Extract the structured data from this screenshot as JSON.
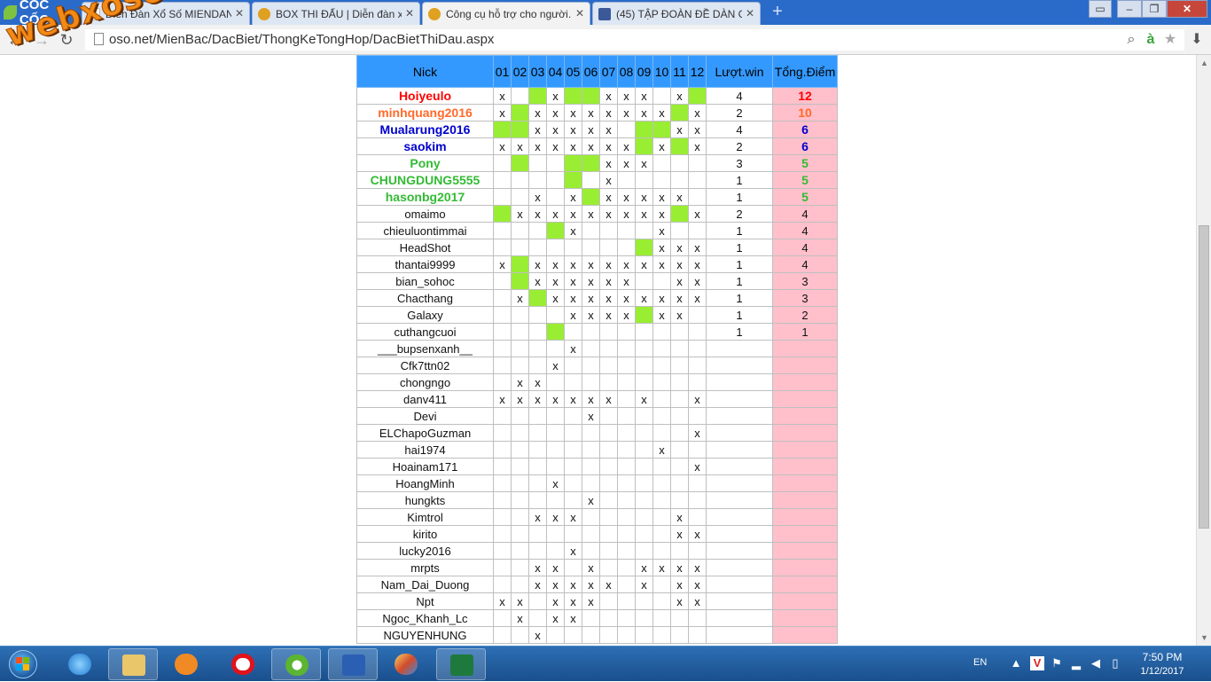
{
  "browser": {
    "brand": "CỐC CỐC",
    "tabs": [
      {
        "title": "Diễn Đàn Xổ Số MIENDAN...",
        "icon": "page-icon",
        "color": "#eeeeee"
      },
      {
        "title": "BOX THI ĐẤU | Diễn đàn xổ...",
        "icon": "xs-icon",
        "color": "#e0a020"
      },
      {
        "title": "Công cụ hỗ trợ cho người...",
        "icon": "xs-icon",
        "color": "#e0a020",
        "active": true
      },
      {
        "title": "(45) TẬP ĐOÀN ĐỀ DÀN G...",
        "icon": "facebook-icon",
        "color": "#3b5998"
      }
    ],
    "url": "oso.net/MienBac/DacBiet/ThongKeTongHop/DacBietThiDau.aspx",
    "watermark": "webxoso.net"
  },
  "table": {
    "headers": {
      "nick": "Nick",
      "days": [
        "01",
        "02",
        "03",
        "04",
        "05",
        "06",
        "07",
        "08",
        "09",
        "10",
        "11",
        "12"
      ],
      "win": "Lượt.win",
      "points": "Tổng.Điểm"
    },
    "rows": [
      {
        "nick": "Hoiyeulo",
        "color": "#ff0000",
        "cells": [
          "x",
          "",
          "G",
          "x",
          "G",
          "G",
          "x",
          "x",
          "x",
          "",
          "x",
          "G"
        ],
        "win": "4",
        "points": "12"
      },
      {
        "nick": "minhquang2016",
        "color": "#ff6a2a",
        "cells": [
          "x",
          "G",
          "x",
          "x",
          "x",
          "x",
          "x",
          "x",
          "x",
          "x",
          "G",
          "x"
        ],
        "win": "2",
        "points": "10"
      },
      {
        "nick": "Mualarung2016",
        "color": "#0000cc",
        "cells": [
          "G",
          "G",
          "x",
          "x",
          "x",
          "x",
          "x",
          "",
          "G",
          "G",
          "x",
          "x"
        ],
        "win": "4",
        "points": "6"
      },
      {
        "nick": "saokim",
        "color": "#0000cc",
        "cells": [
          "x",
          "x",
          "x",
          "x",
          "x",
          "x",
          "x",
          "x",
          "G",
          "x",
          "G",
          "x"
        ],
        "win": "2",
        "points": "6"
      },
      {
        "nick": "Pony",
        "color": "#33bb33",
        "cells": [
          "",
          "G",
          "",
          "",
          "G",
          "G",
          "x",
          "x",
          "x",
          "",
          "",
          ""
        ],
        "win": "3",
        "points": "5"
      },
      {
        "nick": "CHUNGDUNG5555",
        "color": "#33bb33",
        "cells": [
          "",
          "",
          "",
          "",
          "G",
          "",
          "x",
          "",
          "",
          "",
          "",
          ""
        ],
        "win": "1",
        "points": "5"
      },
      {
        "nick": "hasonbg2017",
        "color": "#33bb33",
        "cells": [
          "",
          "",
          "x",
          "",
          "x",
          "G",
          "x",
          "x",
          "x",
          "x",
          "x",
          ""
        ],
        "win": "1",
        "points": "5"
      },
      {
        "nick": "omaimo",
        "color": "",
        "cells": [
          "G",
          "x",
          "x",
          "x",
          "x",
          "x",
          "x",
          "x",
          "x",
          "x",
          "G",
          "x"
        ],
        "win": "2",
        "points": "4"
      },
      {
        "nick": "chieuluontimmai",
        "color": "",
        "cells": [
          "",
          "",
          "",
          "G",
          "x",
          "",
          "",
          "",
          "",
          "x",
          "",
          ""
        ],
        "win": "1",
        "points": "4"
      },
      {
        "nick": "HeadShot",
        "color": "",
        "cells": [
          "",
          "",
          "",
          "",
          "",
          "",
          "",
          "",
          "G",
          "x",
          "x",
          "x"
        ],
        "win": "1",
        "points": "4"
      },
      {
        "nick": "thantai9999",
        "color": "",
        "cells": [
          "x",
          "G",
          "x",
          "x",
          "x",
          "x",
          "x",
          "x",
          "x",
          "x",
          "x",
          "x"
        ],
        "win": "1",
        "points": "4"
      },
      {
        "nick": "bian_sohoc",
        "color": "",
        "cells": [
          "",
          "G",
          "x",
          "x",
          "x",
          "x",
          "x",
          "x",
          "",
          "",
          "x",
          "x"
        ],
        "win": "1",
        "points": "3"
      },
      {
        "nick": "Chacthang",
        "color": "",
        "cells": [
          "",
          "x",
          "G",
          "x",
          "x",
          "x",
          "x",
          "x",
          "x",
          "x",
          "x",
          "x"
        ],
        "win": "1",
        "points": "3"
      },
      {
        "nick": "Galaxy",
        "color": "",
        "cells": [
          "",
          "",
          "",
          "",
          "x",
          "x",
          "x",
          "x",
          "G",
          "x",
          "x",
          ""
        ],
        "win": "1",
        "points": "2"
      },
      {
        "nick": "cuthangcuoi",
        "color": "",
        "cells": [
          "",
          "",
          "",
          "G",
          "",
          "",
          "",
          "",
          "",
          "",
          "",
          ""
        ],
        "win": "1",
        "points": "1"
      },
      {
        "nick": "___bupsenxanh__",
        "color": "",
        "cells": [
          "",
          "",
          "",
          "",
          "x",
          "",
          "",
          "",
          "",
          "",
          "",
          ""
        ],
        "win": "",
        "points": ""
      },
      {
        "nick": "Cfk7ttn02",
        "color": "",
        "cells": [
          "",
          "",
          "",
          "x",
          "",
          "",
          "",
          "",
          "",
          "",
          "",
          ""
        ],
        "win": "",
        "points": ""
      },
      {
        "nick": "chongngo",
        "color": "",
        "cells": [
          "",
          "x",
          "x",
          "",
          "",
          "",
          "",
          "",
          "",
          "",
          "",
          ""
        ],
        "win": "",
        "points": ""
      },
      {
        "nick": "danv411",
        "color": "",
        "cells": [
          "x",
          "x",
          "x",
          "x",
          "x",
          "x",
          "x",
          "",
          "x",
          "",
          "",
          "x"
        ],
        "win": "",
        "points": ""
      },
      {
        "nick": "Devi",
        "color": "",
        "cells": [
          "",
          "",
          "",
          "",
          "",
          "x",
          "",
          "",
          "",
          "",
          "",
          ""
        ],
        "win": "",
        "points": ""
      },
      {
        "nick": "ELChapoGuzman",
        "color": "",
        "cells": [
          "",
          "",
          "",
          "",
          "",
          "",
          "",
          "",
          "",
          "",
          "",
          "x"
        ],
        "win": "",
        "points": ""
      },
      {
        "nick": "hai1974",
        "color": "",
        "cells": [
          "",
          "",
          "",
          "",
          "",
          "",
          "",
          "",
          "",
          "x",
          "",
          ""
        ],
        "win": "",
        "points": ""
      },
      {
        "nick": "Hoainam171",
        "color": "",
        "cells": [
          "",
          "",
          "",
          "",
          "",
          "",
          "",
          "",
          "",
          "",
          "",
          "x"
        ],
        "win": "",
        "points": ""
      },
      {
        "nick": "HoangMinh",
        "color": "",
        "cells": [
          "",
          "",
          "",
          "x",
          "",
          "",
          "",
          "",
          "",
          "",
          "",
          ""
        ],
        "win": "",
        "points": ""
      },
      {
        "nick": "hungkts",
        "color": "",
        "cells": [
          "",
          "",
          "",
          "",
          "",
          "x",
          "",
          "",
          "",
          "",
          "",
          ""
        ],
        "win": "",
        "points": ""
      },
      {
        "nick": "Kimtrol",
        "color": "",
        "cells": [
          "",
          "",
          "x",
          "x",
          "x",
          "",
          "",
          "",
          "",
          "",
          "x",
          ""
        ],
        "win": "",
        "points": ""
      },
      {
        "nick": "kirito",
        "color": "",
        "cells": [
          "",
          "",
          "",
          "",
          "",
          "",
          "",
          "",
          "",
          "",
          "x",
          "x"
        ],
        "win": "",
        "points": ""
      },
      {
        "nick": "lucky2016",
        "color": "",
        "cells": [
          "",
          "",
          "",
          "",
          "x",
          "",
          "",
          "",
          "",
          "",
          "",
          ""
        ],
        "win": "",
        "points": ""
      },
      {
        "nick": "mrpts",
        "color": "",
        "cells": [
          "",
          "",
          "x",
          "x",
          "",
          "x",
          "",
          "",
          "x",
          "x",
          "x",
          "x"
        ],
        "win": "",
        "points": ""
      },
      {
        "nick": "Nam_Dai_Duong",
        "color": "",
        "cells": [
          "",
          "",
          "x",
          "x",
          "x",
          "x",
          "x",
          "",
          "x",
          "",
          "x",
          "x"
        ],
        "win": "",
        "points": ""
      },
      {
        "nick": "Npt",
        "color": "",
        "cells": [
          "x",
          "x",
          "",
          "x",
          "x",
          "x",
          "",
          "",
          "",
          "",
          "x",
          "x"
        ],
        "win": "",
        "points": ""
      },
      {
        "nick": "Ngoc_Khanh_Lc",
        "color": "",
        "cells": [
          "",
          "x",
          "",
          "x",
          "x",
          "",
          "",
          "",
          "",
          "",
          "",
          ""
        ],
        "win": "",
        "points": ""
      },
      {
        "nick": "NGUYENHUNG",
        "color": "",
        "cells": [
          "",
          "",
          "x",
          "",
          "",
          "",
          "",
          "",
          "",
          "",
          "",
          ""
        ],
        "win": "",
        "points": ""
      }
    ]
  },
  "taskbar": {
    "apps": [
      "ie-icon",
      "explorer-icon",
      "media-player-icon",
      "opera-icon",
      "coccoc-icon",
      "word-icon",
      "paint-icon",
      "excel-icon"
    ],
    "language": "EN",
    "time": "7:50 PM",
    "date": "1/12/2017"
  }
}
